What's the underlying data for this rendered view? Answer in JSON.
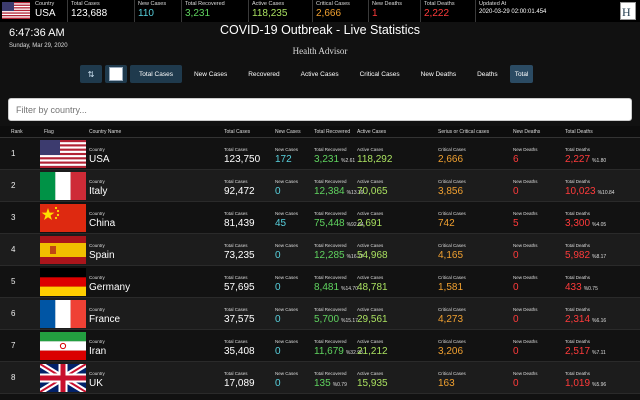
{
  "topbar": {
    "country_label": "Country",
    "country": "USA",
    "stats": [
      {
        "label": "Total Cases",
        "value": "123,688",
        "color": "#ffffff"
      },
      {
        "label": "New Cases",
        "value": "110",
        "color": "#58d0dd"
      },
      {
        "label": "Total Recovered",
        "value": "3,231",
        "color": "#5fd35f"
      },
      {
        "label": "Active Cases",
        "value": "118,235",
        "color": "#a9e060"
      },
      {
        "label": "Critical Cases",
        "value": "2,666",
        "color": "#f0a030"
      },
      {
        "label": "New Deaths",
        "value": "1",
        "color": "#ff3b3b"
      },
      {
        "label": "Total Deaths",
        "value": "2,222",
        "color": "#ff3b3b"
      }
    ],
    "updated_label": "Updated At",
    "updated_value": "2020-03-29 02:00:01.454"
  },
  "clock": "6:47:36 AM",
  "date": "Sunday, Mar 29, 2020",
  "title": "COVID-19 Outbreak - Live Statistics",
  "subtitle": "Health Advisor",
  "tabs": [
    "Total Cases",
    "New Cases",
    "Recovered",
    "Active Cases",
    "Critical Cases",
    "New Deaths",
    "Deaths",
    "Total"
  ],
  "filter_placeholder": "Filter by country...",
  "table": {
    "headers": [
      "Rank",
      "Flag",
      "Country Name",
      "Total Cases",
      "New Cases",
      "Total Recovered",
      "Active Cases",
      "Serius or Critical cases",
      "New Deaths",
      "Total Deaths"
    ],
    "sub_labels": {
      "country": "Country",
      "total_cases": "Total Cases",
      "new_cases": "New Cases",
      "recovered": "Total Recovered",
      "active": "Active Cases",
      "critical": "Critical Cases",
      "new_deaths": "New Deaths",
      "total_deaths": "Total Deaths"
    },
    "rows": [
      {
        "rank": "1",
        "flag": "usa",
        "country": "USA",
        "total": "123,750",
        "new": "172",
        "recovered": "3,231",
        "rec_pct": "%2.61",
        "active": "118,292",
        "critical": "2,666",
        "new_deaths": "6",
        "deaths": "2,227",
        "death_pct": "%1.80"
      },
      {
        "rank": "2",
        "flag": "italy",
        "country": "Italy",
        "total": "92,472",
        "new": "0",
        "recovered": "12,384",
        "rec_pct": "%13.39",
        "active": "70,065",
        "critical": "3,856",
        "new_deaths": "0",
        "deaths": "10,023",
        "death_pct": "%10.84"
      },
      {
        "rank": "3",
        "flag": "china",
        "country": "China",
        "total": "81,439",
        "new": "45",
        "recovered": "75,448",
        "rec_pct": "%92.64",
        "active": "2,691",
        "critical": "742",
        "new_deaths": "5",
        "deaths": "3,300",
        "death_pct": "%4.05"
      },
      {
        "rank": "4",
        "flag": "spain",
        "country": "Spain",
        "total": "73,235",
        "new": "0",
        "recovered": "12,285",
        "rec_pct": "%16.77",
        "active": "54,968",
        "critical": "4,165",
        "new_deaths": "0",
        "deaths": "5,982",
        "death_pct": "%8.17"
      },
      {
        "rank": "5",
        "flag": "germany",
        "country": "Germany",
        "total": "57,695",
        "new": "0",
        "recovered": "8,481",
        "rec_pct": "%14.70",
        "active": "48,781",
        "critical": "1,581",
        "new_deaths": "0",
        "deaths": "433",
        "death_pct": "%0.75"
      },
      {
        "rank": "6",
        "flag": "france",
        "country": "France",
        "total": "37,575",
        "new": "0",
        "recovered": "5,700",
        "rec_pct": "%15.17",
        "active": "29,561",
        "critical": "4,273",
        "new_deaths": "0",
        "deaths": "2,314",
        "death_pct": "%6.16"
      },
      {
        "rank": "7",
        "flag": "iran",
        "country": "Iran",
        "total": "35,408",
        "new": "0",
        "recovered": "11,679",
        "rec_pct": "%32.98",
        "active": "21,212",
        "critical": "3,206",
        "new_deaths": "0",
        "deaths": "2,517",
        "death_pct": "%7.11"
      },
      {
        "rank": "8",
        "flag": "uk",
        "country": "UK",
        "total": "17,089",
        "new": "0",
        "recovered": "135",
        "rec_pct": "%0.79",
        "active": "15,935",
        "critical": "163",
        "new_deaths": "0",
        "deaths": "1,019",
        "death_pct": "%5.96"
      }
    ]
  }
}
